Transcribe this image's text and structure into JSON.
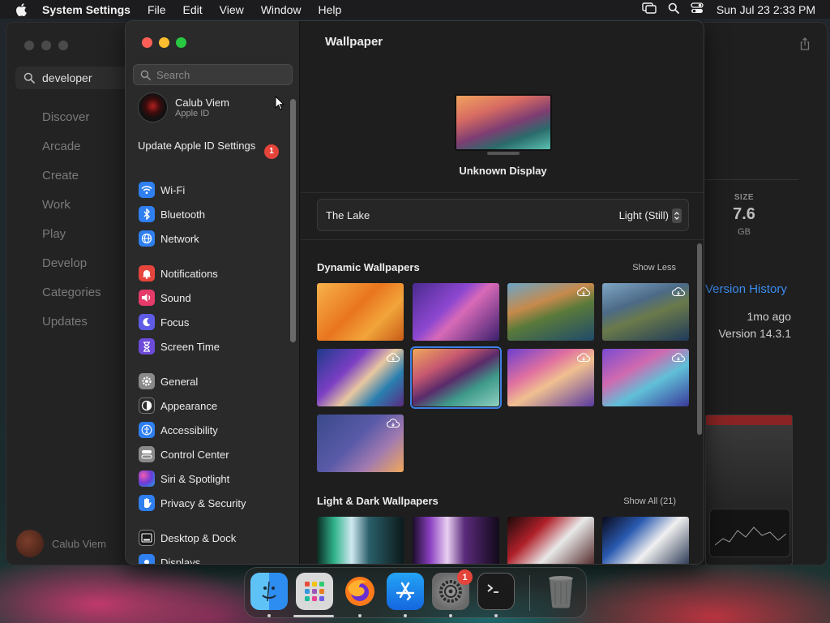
{
  "menubar": {
    "app_name": "System Settings",
    "menus": [
      "File",
      "Edit",
      "View",
      "Window",
      "Help"
    ],
    "clock": "Sun Jul 23  2:33 PM"
  },
  "appstore": {
    "search_value": "developer",
    "nav": [
      "Discover",
      "Arcade",
      "Create",
      "Work",
      "Play",
      "Develop",
      "Categories",
      "Updates"
    ],
    "user_name": "Calub Viem",
    "size_label": "SIZE",
    "size_value": "7.6",
    "size_unit": "GB",
    "version_history": "Version History",
    "updated_ago": "1mo ago",
    "version": "Version 14.3.1"
  },
  "settings": {
    "search_placeholder": "Search",
    "profile": {
      "name": "Calub Viem",
      "subtitle": "Apple ID"
    },
    "update_notice": "Update Apple ID Settings",
    "update_badge": "1",
    "sidebar_groups": [
      [
        {
          "label": "Wi-Fi",
          "icon": "wifi-icon"
        },
        {
          "label": "Bluetooth",
          "icon": "bluetooth-icon"
        },
        {
          "label": "Network",
          "icon": "globe-icon"
        }
      ],
      [
        {
          "label": "Notifications",
          "icon": "bell-icon"
        },
        {
          "label": "Sound",
          "icon": "speaker-icon"
        },
        {
          "label": "Focus",
          "icon": "moon-icon"
        },
        {
          "label": "Screen Time",
          "icon": "hourglass-icon"
        }
      ],
      [
        {
          "label": "General",
          "icon": "gear-icon"
        },
        {
          "label": "Appearance",
          "icon": "appearance-icon"
        },
        {
          "label": "Accessibility",
          "icon": "accessibility-icon"
        },
        {
          "label": "Control Center",
          "icon": "control-center-icon"
        },
        {
          "label": "Siri & Spotlight",
          "icon": "siri-icon"
        },
        {
          "label": "Privacy & Security",
          "icon": "hand-icon"
        }
      ],
      [
        {
          "label": "Desktop & Dock",
          "icon": "dock-icon"
        },
        {
          "label": "Displays",
          "icon": "display-icon"
        }
      ]
    ],
    "pane_title": "Wallpaper",
    "display_name": "Unknown Display",
    "current_wallpaper": "The Lake",
    "wallpaper_mode": "Light (Still)",
    "sections": [
      {
        "title": "Dynamic Wallpapers",
        "link": "Show Less"
      },
      {
        "title": "Light & Dark Wallpapers",
        "link": "Show All (21)"
      }
    ]
  },
  "dock": {
    "apps": [
      "Finder",
      "Launchpad",
      "Firefox",
      "App Store",
      "System Settings",
      "Terminal",
      "Trash"
    ],
    "settings_badge": "1"
  },
  "colors": {
    "accent": "#3d7fe6",
    "badge": "#e5443a",
    "link": "#3a8cf0"
  }
}
